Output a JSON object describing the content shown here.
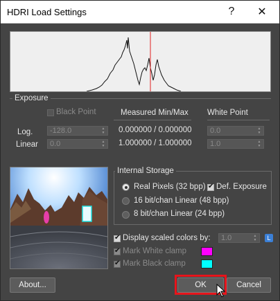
{
  "window": {
    "title": "HDRI Load Settings",
    "help_label": "?",
    "close_label": "✕"
  },
  "exposure": {
    "group_label": "Exposure",
    "black_point_label": "Black Point",
    "black_point_checked": false,
    "measured_header": "Measured Min/Max",
    "white_point_header": "White Point",
    "log_label": "Log.",
    "linear_label": "Linear",
    "log_black_value": "-128.0",
    "linear_black_value": "0.0",
    "log_measured": "0.000000 / 0.000000",
    "linear_measured": "1.000000 / 1.000000",
    "log_white_value": "0.0",
    "linear_white_value": "1.0"
  },
  "storage": {
    "group_label": "Internal Storage",
    "options": [
      {
        "label": "Real Pixels (32 bpp)",
        "selected": true
      },
      {
        "label": "16 bit/chan Linear (48 bpp)",
        "selected": false
      },
      {
        "label": "8 bit/chan Linear (24 bpp)",
        "selected": false
      }
    ],
    "def_exposure_label": "Def. Exposure",
    "def_exposure_checked": true
  },
  "display": {
    "scaled_colors_label": "Display scaled colors by:",
    "scaled_colors_checked": true,
    "scale_value": "1.0",
    "lock_label": "L",
    "mark_white_label": "Mark White clamp",
    "mark_white_checked": true,
    "mark_white_color": "#ff00ff",
    "mark_black_label": "Mark Black clamp",
    "mark_black_checked": true,
    "mark_black_color": "#00ffff"
  },
  "buttons": {
    "about": "About...",
    "ok": "OK",
    "cancel": "Cancel"
  },
  "colors": {
    "histogram_marker": "#e02020",
    "highlight": "#e8141b"
  },
  "icons": {
    "cursor": "pointer-cursor-icon"
  }
}
